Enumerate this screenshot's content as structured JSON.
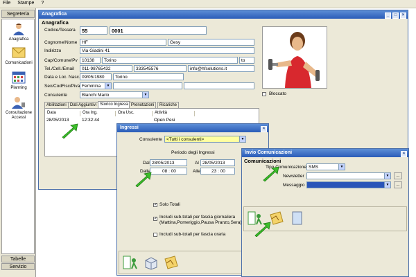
{
  "menu": [
    "File",
    "Stampe",
    "?"
  ],
  "sidebar": {
    "header": "Segreteria",
    "items": [
      {
        "label": "Anagrafica",
        "icon": "user-icon"
      },
      {
        "label": "Comunicazioni",
        "icon": "envelope-icon"
      },
      {
        "label": "Planning",
        "icon": "calendar-icon"
      },
      {
        "label": "Consultazione Accessi",
        "icon": "user-key-icon"
      }
    ],
    "footer": [
      "Tabelle",
      "Servizio"
    ]
  },
  "anagrafica": {
    "title": "Anagrafica",
    "section": "Anagrafica",
    "codice_label": "Codice/Tessera",
    "codice_a": "55",
    "codice_b": "0001",
    "cognome_label": "Cognome/Nome",
    "cognome": "HF",
    "nome": "Gesy",
    "indirizzo_label": "Indirizzo",
    "indirizzo": "Via Giadini 41",
    "cap_label": "Cap/Comune/Pv",
    "cap": "10138",
    "comune": "Torino",
    "pv": "to",
    "tel_label": "Tel./Cell./Email",
    "tel": "011-98765432",
    "cell": "333545576",
    "email": "info@hfsolutions.it",
    "nascita_label": "Data e Loc. Nasc.",
    "nascita_data": "09/05/1980",
    "nascita_luogo": "Torino",
    "sesso_label": "Sex/CodFisc/Piva",
    "sesso": "Femmina",
    "consulente_label": "Consulente",
    "consulente": "Bianchi Mario",
    "bloccato_label": "Bloccato",
    "tabs": [
      "Abilitazioni",
      "Dati Aggiuntivi",
      "Storico Ingressi",
      "Prenotazioni",
      "Ricariche"
    ],
    "grid": {
      "headers": [
        "Data",
        "Ora Ing.",
        "Ora Usc.",
        "Attività"
      ],
      "rows": [
        [
          "28/05/2013",
          "12:32:44",
          "",
          "Open Pesi"
        ]
      ]
    }
  },
  "ingressi": {
    "title": "Ingressi",
    "consulente_label": "Consulente",
    "consulente_value": "<Tutti i consulenti>",
    "periodo_label": "Periodo degli Ingressi",
    "dal_label": "Dal",
    "dal": "28/05/2013",
    "al_label": "Al",
    "al": "28/05/2013",
    "dalle_label": "Dalle",
    "dalle": "08 : 00",
    "alle_label": "Alle",
    "alle": "23 : 00",
    "solo_totali": "Solo Totali",
    "subtotali_fascia": "Includi sub-totali per fascia giornaliera (Mattina,Pomeriggio,Pausa Pranzo,Sera)",
    "subtotali_oraria": "Includi sub-totali per fascia oraria"
  },
  "comunicazioni": {
    "title": "Invio Comunicazioni",
    "section": "Comunicazioni",
    "tipo_label": "Tipo Comunicazione",
    "tipo_value": "SMS",
    "newsletter_label": "Newsletter",
    "messaggio_label": "Messaggio"
  },
  "colors": {
    "titlebar": "#2a5cb8",
    "arrow": "#3bbf2a",
    "highlight": "#ffffa0",
    "selection": "#2a55b8"
  }
}
